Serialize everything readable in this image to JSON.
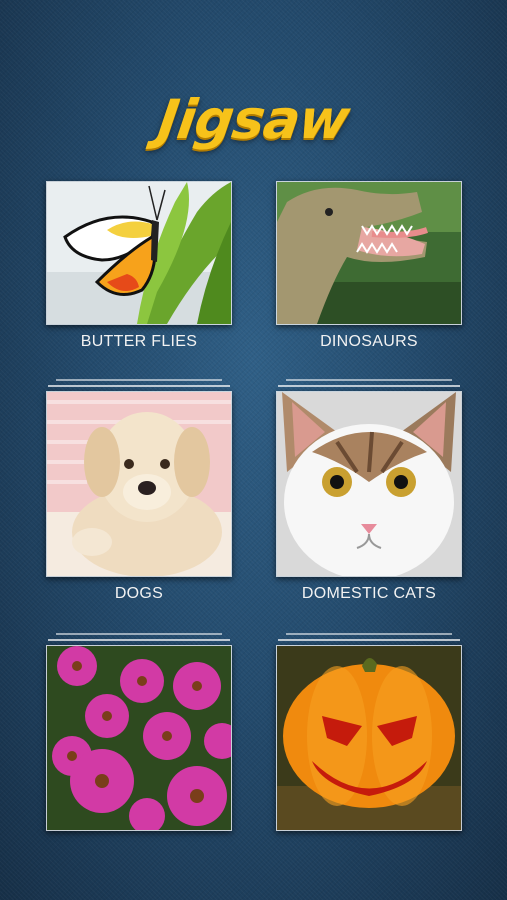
{
  "app": {
    "title": "Jigsaw"
  },
  "categories": [
    {
      "label": "BUTTER FLIES",
      "icon": "butterfly-image"
    },
    {
      "label": "DINOSAURS",
      "icon": "dinosaur-image"
    },
    {
      "label": "DOGS",
      "icon": "puppy-image"
    },
    {
      "label": "DOMESTIC CATS",
      "icon": "cat-image"
    },
    {
      "label": "",
      "icon": "flowers-image"
    },
    {
      "label": "",
      "icon": "pumpkin-image"
    }
  ],
  "colors": {
    "title": "#f7c21a",
    "background": "#234a6c",
    "label": "#f2f2f2"
  }
}
